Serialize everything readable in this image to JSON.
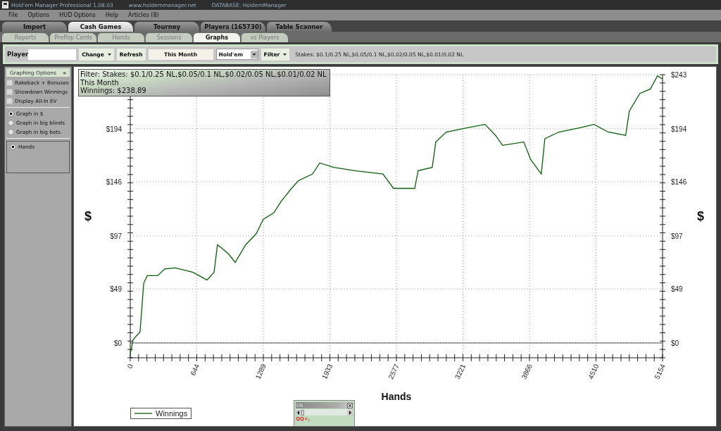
{
  "window": {
    "title": "Hold'em Manager Professional 1.08.03",
    "website": "www.holdemmanager.net",
    "database": "DATABASE: HoldemManager"
  },
  "menu": [
    "File",
    "Options",
    "HUD Options",
    "Help",
    "Articles (8)"
  ],
  "tabs": [
    {
      "label": "Import",
      "selected": false
    },
    {
      "label": "Cash Games",
      "selected": true
    },
    {
      "label": "Tourney",
      "selected": false
    },
    {
      "label": "Players (165730)",
      "selected": false
    },
    {
      "label": "Table Scanner",
      "selected": false
    }
  ],
  "subtabs": [
    {
      "label": "Reports",
      "selected": false
    },
    {
      "label": "Preflop Cards",
      "selected": false
    },
    {
      "label": "Hands",
      "selected": false
    },
    {
      "label": "Sessions",
      "selected": false
    },
    {
      "label": "Graphs",
      "selected": true
    },
    {
      "label": "vs Players",
      "selected": false
    }
  ],
  "toolbar": {
    "player_label": "Player",
    "change": "Change",
    "refresh": "Refresh",
    "period": "This Month",
    "game": "Hold'em",
    "filter": "Filter",
    "stakes": "Stakes: $0.1/0.25 NL,$0.05/0.1 NL,$0.02/0.05 NL,$0.01/0.02 NL"
  },
  "options": {
    "title": "Graphing Options",
    "collapse": "«",
    "checkboxes": [
      {
        "label": "Rakeback + Bonuses",
        "checked": false
      },
      {
        "label": "Showdown Winnings",
        "checked": false
      },
      {
        "label": "Display All-In EV",
        "checked": false
      }
    ],
    "units": [
      {
        "label": "Graph in $",
        "selected": true
      },
      {
        "label": "Graph in big blinds",
        "selected": false
      },
      {
        "label": "Graph in big bets",
        "selected": false
      }
    ],
    "axis": [
      {
        "label": "Hands",
        "selected": true
      }
    ]
  },
  "graph": {
    "info": [
      "Filter: Stakes: $0.1/0.25 NL,$0.05/0.1 NL,$0.02/0.05 NL,$0.01/0.02 NL",
      "This Month",
      "Winnings: $238.89"
    ],
    "right_ylabel": "$",
    "right_ticks": [
      "$243",
      "$194",
      "$146",
      "$97",
      "$49",
      "$0"
    ],
    "chart_data": {
      "type": "line",
      "xlabel": "Hands",
      "ylabel": "$",
      "x": [
        0,
        27,
        95,
        130,
        164,
        266,
        334,
        436,
        607,
        743,
        811,
        845,
        948,
        1016,
        1118,
        1220,
        1288,
        1391,
        1459,
        1561,
        1629,
        1765,
        1834,
        1970,
        2174,
        2447,
        2549,
        2754,
        2788,
        2924,
        2958,
        3060,
        3265,
        3435,
        3537,
        3605,
        3810,
        3878,
        3980,
        4014,
        4150,
        4355,
        4491,
        4627,
        4797,
        4832,
        4934,
        5036,
        5104,
        5154
      ],
      "series": [
        {
          "name": "Winnings",
          "color": "#0b5d0b",
          "values": [
            -10,
            3,
            10,
            54,
            61,
            61,
            67,
            68,
            64,
            57,
            64,
            89,
            81,
            73,
            89,
            99,
            112,
            118,
            128,
            140,
            147,
            153,
            163,
            159,
            156,
            153,
            140,
            140,
            156,
            159,
            182,
            191,
            195,
            198,
            188,
            179,
            182,
            166,
            153,
            185,
            191,
            195,
            198,
            191,
            188,
            210,
            226,
            230,
            242,
            239
          ]
        }
      ],
      "grid": true,
      "xlim": [
        0,
        5154
      ],
      "ylim": [
        -13.4,
        243
      ],
      "xticks": [
        0,
        644,
        1289,
        1933,
        2577,
        3221,
        3866,
        4510,
        5154
      ],
      "yticks": [
        {
          "value": 0,
          "label": "$0"
        },
        {
          "value": 49,
          "label": "$49"
        },
        {
          "value": 97,
          "label": "$97"
        },
        {
          "value": 146,
          "label": "$146"
        },
        {
          "value": 194,
          "label": "$194"
        }
      ]
    }
  },
  "popup": {
    "title": "1%",
    "text": "QQ+,"
  }
}
